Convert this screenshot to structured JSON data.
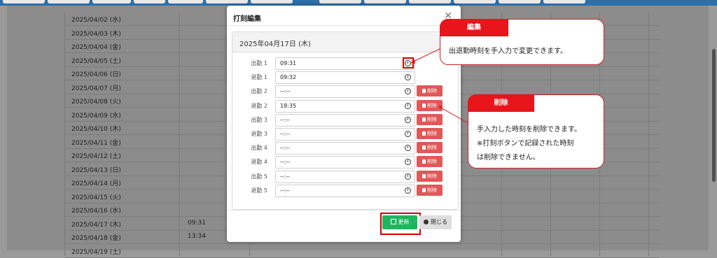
{
  "background": {
    "rows": [
      {
        "date": "2025/04/02 (水)",
        "time": ""
      },
      {
        "date": "2025/04/03 (木)",
        "time": ""
      },
      {
        "date": "2025/04/04 (金)",
        "time": ""
      },
      {
        "date": "2025/04/05 (土)",
        "time": ""
      },
      {
        "date": "2025/04/06 (日)",
        "time": ""
      },
      {
        "date": "2025/04/07 (月)",
        "time": ""
      },
      {
        "date": "2025/04/08 (火)",
        "time": ""
      },
      {
        "date": "2025/04/09 (水)",
        "time": ""
      },
      {
        "date": "2025/04/10 (木)",
        "time": ""
      },
      {
        "date": "2025/04/11 (金)",
        "time": ""
      },
      {
        "date": "2025/04/12 (土)",
        "time": ""
      },
      {
        "date": "2025/04/13 (日)",
        "time": ""
      },
      {
        "date": "2025/04/14 (月)",
        "time": ""
      },
      {
        "date": "2025/04/15 (火)",
        "time": ""
      },
      {
        "date": "2025/04/16 (水)",
        "time": ""
      },
      {
        "date": "2025/04/17 (木)",
        "time": "09:31"
      },
      {
        "date": "2025/04/18 (金)",
        "time": "13:34"
      },
      {
        "date": "2025/04/19 (土)",
        "time": ""
      }
    ]
  },
  "modal": {
    "title": "打刻編集",
    "close_icon": "close-icon",
    "date_header": "2025年04月17日 (木)",
    "fields": [
      {
        "label": "出勤 1",
        "value": "09:31",
        "delete": ""
      },
      {
        "label": "退勤 1",
        "value": "09:32",
        "delete": ""
      },
      {
        "label": "出勤 2",
        "value": "--:--",
        "delete": "削除"
      },
      {
        "label": "退勤 2",
        "value": "18:35",
        "delete": "削除"
      },
      {
        "label": "出勤 3",
        "value": "--:--",
        "delete": "削除"
      },
      {
        "label": "退勤 3",
        "value": "--:--",
        "delete": "削除"
      },
      {
        "label": "出勤 4",
        "value": "--:--",
        "delete": "削除"
      },
      {
        "label": "退勤 4",
        "value": "--:--",
        "delete": "削除"
      },
      {
        "label": "出勤 5",
        "value": "--:--",
        "delete": "削除"
      },
      {
        "label": "退勤 5",
        "value": "--:--",
        "delete": "削除"
      }
    ],
    "update_label": "更新",
    "close_label": "閉じる"
  },
  "callouts": {
    "edit": {
      "tag": "編集",
      "text": "出退勤時刻を手入力で変更できます。"
    },
    "delete": {
      "tag": "削除",
      "lines": [
        "手入力した時刻を削除できます。",
        "※打刻ボタンで記録された時刻",
        "は削除できません。"
      ]
    }
  },
  "colors": {
    "accent_red": "#e8151b",
    "update_green": "#1fb55f",
    "delete_red": "#e05858",
    "topbar_blue": "#2d6fa8"
  }
}
